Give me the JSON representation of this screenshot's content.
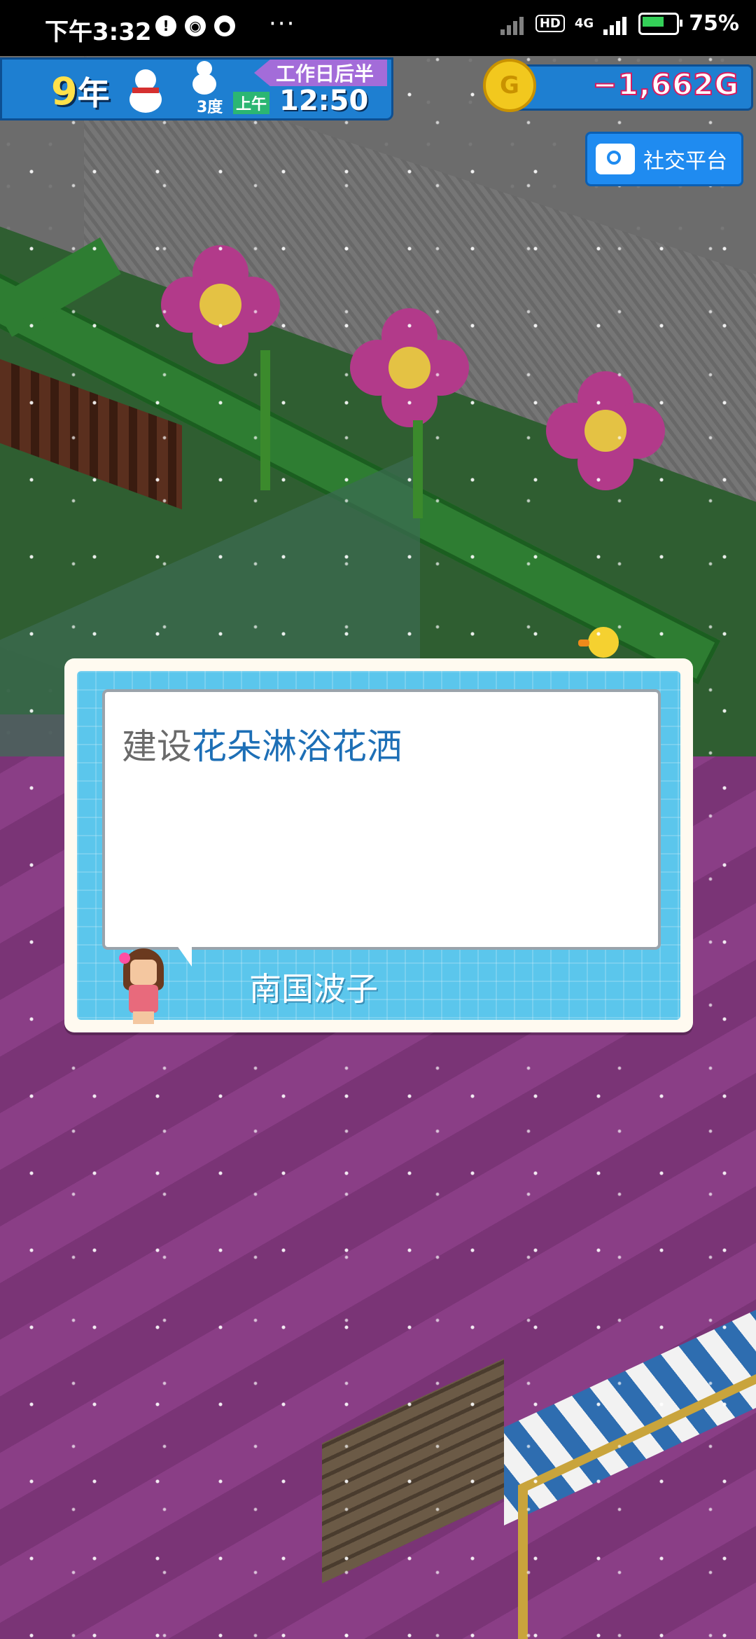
{
  "status_bar": {
    "time": "下午3:32",
    "more": "···",
    "hd": "HD",
    "network": "4G",
    "battery": "75%",
    "battery_level": 0.75
  },
  "hud": {
    "year_number": "9",
    "year_unit": "年",
    "temperature": "3度",
    "ampm": "上午",
    "clock": "12:50",
    "period": "工作日后半"
  },
  "money": {
    "coin_symbol": "G",
    "amount": "−1,662G"
  },
  "social_button": {
    "label": "社交平台"
  },
  "dialog": {
    "prefix": "建设",
    "highlight": "花朵淋浴花洒",
    "speaker": "南国波子"
  },
  "colors": {
    "hud_blue": "#1e7fd1",
    "period_purple": "#a36cd9",
    "money_pink": "#d81b60",
    "dialog_frame": "#5bc6ec",
    "highlight_blue": "#1d6fb6"
  }
}
